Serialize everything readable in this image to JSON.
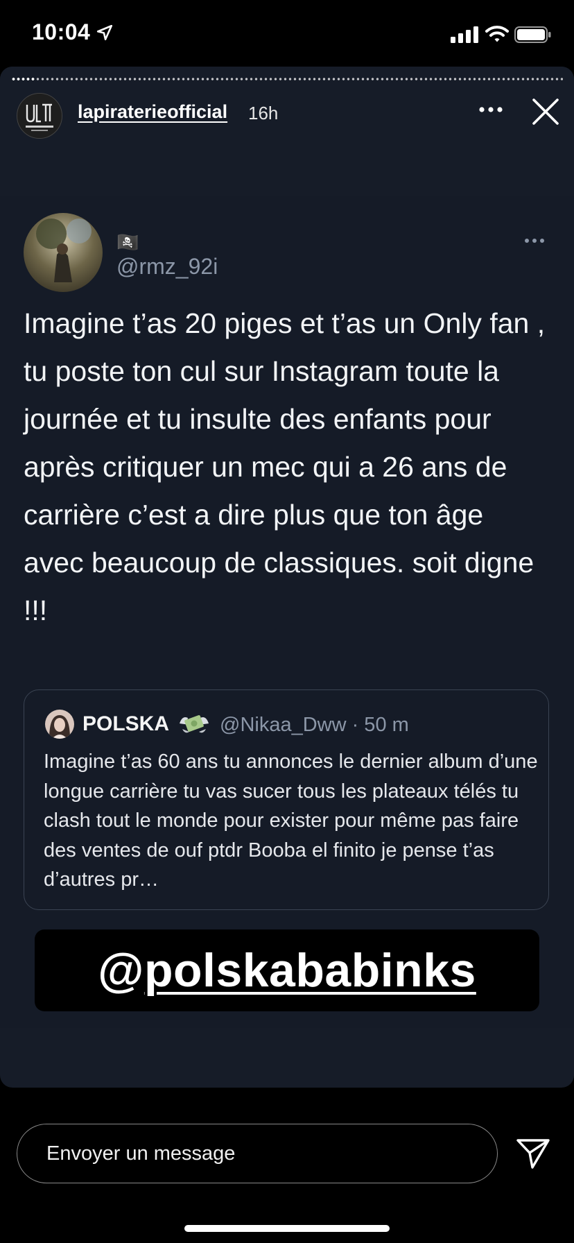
{
  "status_bar": {
    "time": "10:04"
  },
  "story": {
    "username": "lapiraterieofficial",
    "time_ago": "16h",
    "avatar_icon": "booba-ultra-logo-icon"
  },
  "tweet": {
    "flag": "🏴‍☠️",
    "handle": "@rmz_92i",
    "text": "Imagine t’as 20 piges et t’as un Only fan , tu poste ton cul sur Instagram toute la journée et tu insulte des enfants pour après critiquer un mec qui a 26 ans de carrière c’est a dire plus que ton âge avec beaucoup de classiques. soit digne !!!"
  },
  "quote": {
    "name": "POLSKA",
    "emoji_icon": "money-with-wings-icon",
    "handle_time": "@Nikaa_Dww · 50 m",
    "text": "Imagine t’as 60 ans tu annonces le dernier album d’une longue carrière  tu vas sucer tous les plateaux télés tu clash tout le monde pour exister pour même pas faire des ventes de ouf ptdr Booba el finito je pense t’as d’autres pr…"
  },
  "mention": {
    "at": "@",
    "handle": "polskababinks"
  },
  "reply": {
    "placeholder": "Envoyer un message"
  },
  "colors": {
    "story_bg": "#161c28",
    "handle_gray": "#8c97a8",
    "accent_white": "#ffffff"
  }
}
